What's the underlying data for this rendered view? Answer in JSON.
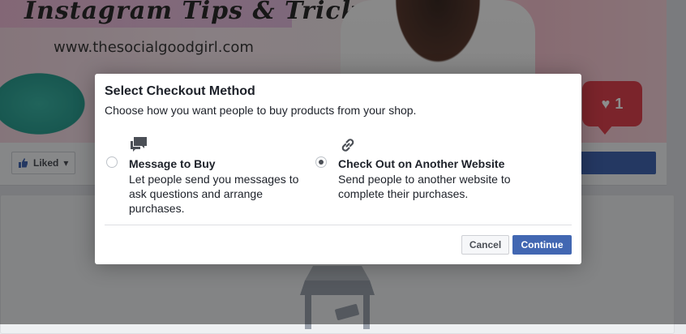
{
  "background": {
    "cover_title": "Instagram Tips & Tricks",
    "cover_url": "www.thesocialgoodgirl.com",
    "heart_count": "1",
    "liked_label": "Liked"
  },
  "dialog": {
    "title": "Select Checkout Method",
    "subtitle": "Choose how you want people to buy products from your shop.",
    "options": [
      {
        "icon": "chat-bubbles-icon",
        "title": "Message to Buy",
        "description": "Let people send you messages to ask questions and arrange purchases.",
        "selected": false
      },
      {
        "icon": "link-icon",
        "title": "Check Out on Another Website",
        "description": "Send people to another website to complete their purchases.",
        "selected": true
      }
    ],
    "cancel_label": "Cancel",
    "continue_label": "Continue"
  },
  "colors": {
    "primary_blue": "#4267b2",
    "text_dark": "#1d2129",
    "heart_red": "#e0434f"
  }
}
